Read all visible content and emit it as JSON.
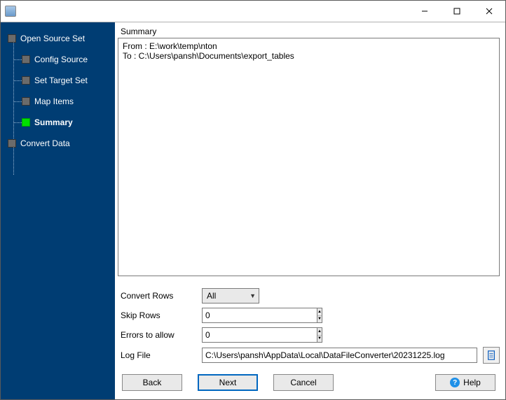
{
  "sidebar": {
    "items": [
      {
        "label": "Open Source Set",
        "level": "top"
      },
      {
        "label": "Config Source",
        "level": "child"
      },
      {
        "label": "Set Target Set",
        "level": "child"
      },
      {
        "label": "Map Items",
        "level": "child"
      },
      {
        "label": "Summary",
        "level": "child",
        "active": true
      },
      {
        "label": "Convert Data",
        "level": "top"
      }
    ]
  },
  "main": {
    "section_label": "Summary",
    "summary_text": "From : E:\\work\\temp\\nton\nTo : C:\\Users\\pansh\\Documents\\export_tables",
    "fields": {
      "convert_rows_label": "Convert Rows",
      "convert_rows_value": "All",
      "skip_rows_label": "Skip Rows",
      "skip_rows_value": "0",
      "errors_label": "Errors to allow",
      "errors_value": "0",
      "log_label": "Log File",
      "log_value": "C:\\Users\\pansh\\AppData\\Local\\DataFileConverter\\20231225.log"
    }
  },
  "buttons": {
    "back": "Back",
    "next": "Next",
    "cancel": "Cancel",
    "help": "Help"
  }
}
